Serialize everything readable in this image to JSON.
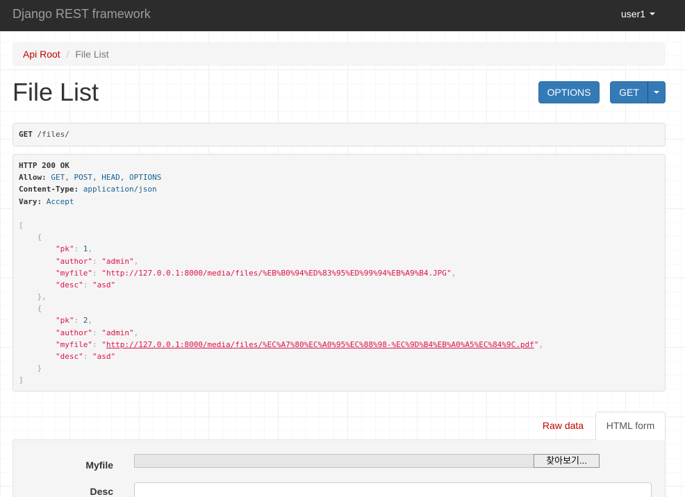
{
  "navbar": {
    "brand": "Django REST framework",
    "user": "user1"
  },
  "breadcrumb": {
    "items": [
      {
        "label": "Api Root"
      },
      {
        "label": "File List"
      }
    ]
  },
  "page": {
    "title": "File List"
  },
  "toolbar": {
    "options_label": "OPTIONS",
    "get_label": "GET"
  },
  "request": {
    "method": "GET",
    "path": "/files/"
  },
  "response": {
    "status": "HTTP 200 OK",
    "headers": [
      {
        "name": "Allow:",
        "value": "GET, POST, HEAD, OPTIONS"
      },
      {
        "name": "Content-Type:",
        "value": "application/json"
      },
      {
        "name": "Vary:",
        "value": "Accept"
      }
    ],
    "items": [
      {
        "fields": [
          {
            "key": "pk",
            "value": 1
          },
          {
            "key": "author",
            "value": "admin"
          },
          {
            "key": "myfile",
            "value": "http://127.0.0.1:8000/media/files/%EB%B0%94%ED%83%95%ED%99%94%EB%A9%B4.JPG"
          },
          {
            "key": "desc",
            "value": "asd"
          }
        ]
      },
      {
        "fields": [
          {
            "key": "pk",
            "value": 2
          },
          {
            "key": "author",
            "value": "admin"
          },
          {
            "key": "myfile",
            "value": "http://127.0.0.1:8000/media/files/%EC%A7%80%EC%A0%95%EC%88%98-%EC%9D%B4%EB%A0%A5%EC%84%9C.pdf",
            "link": true
          },
          {
            "key": "desc",
            "value": "asd"
          }
        ]
      }
    ]
  },
  "tabs": [
    {
      "label": "Raw data",
      "active": false
    },
    {
      "label": "HTML form",
      "active": true
    }
  ],
  "form": {
    "myfile": {
      "label": "Myfile",
      "browse_label": "찾아보기..."
    },
    "desc": {
      "label": "Desc",
      "value": ""
    }
  },
  "icons": {
    "user_menu": "caret-down-icon",
    "get_dropdown": "caret-down-icon"
  },
  "colors": {
    "navbar_bg": "#2c2c2c",
    "link": "#c20000",
    "primary": "#337ab7",
    "json_string": "#dd1144",
    "json_literal": "#195f91",
    "json_punctuation": "#93a1a1"
  }
}
